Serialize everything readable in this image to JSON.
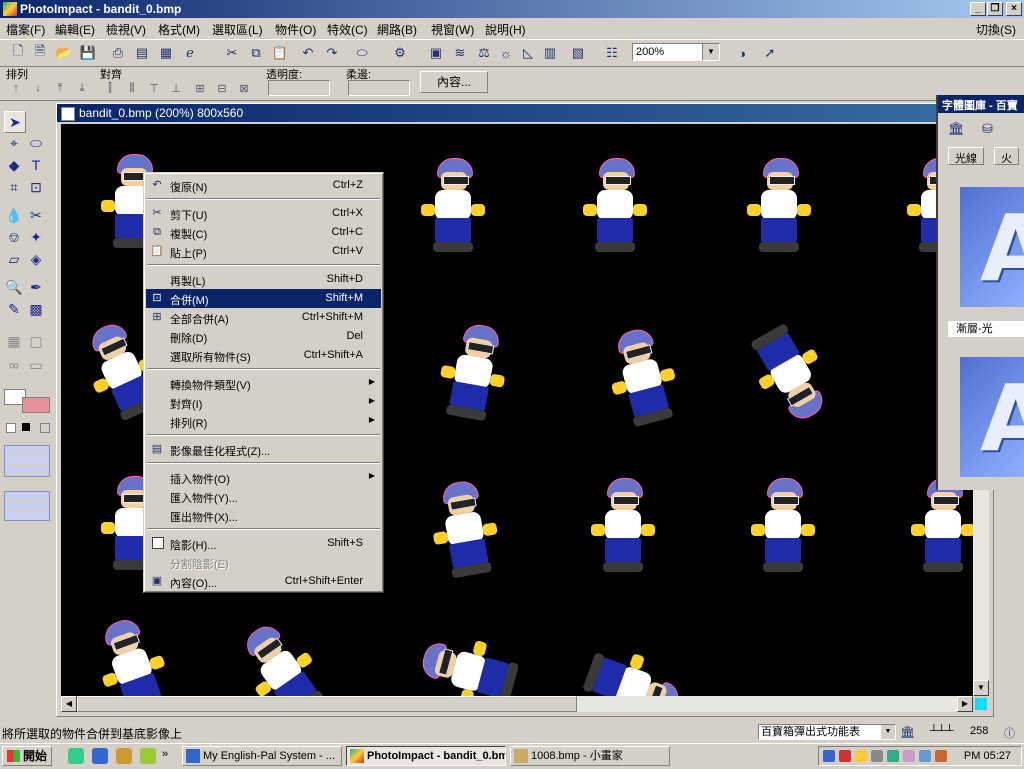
{
  "window": {
    "title": "PhotoImpact - bandit_0.bmp"
  },
  "menubar": {
    "items": [
      "檔案(F)",
      "編輯(E)",
      "檢視(V)",
      "格式(M)",
      "選取區(L)",
      "物件(O)",
      "特效(C)",
      "網路(B)",
      "視窗(W)",
      "說明(H)"
    ],
    "switch_label": "切換(S)"
  },
  "toolbar": {
    "zoom_value": "200%"
  },
  "attribute_bar": {
    "arrange_label": "排列",
    "align_label": "對齊",
    "opacity_label": "透明度:",
    "soft_edge_label": "柔邊:",
    "properties_button": "內容..."
  },
  "document": {
    "title": "bandit_0.bmp (200%) 800x560"
  },
  "context_menu": {
    "items": [
      {
        "label": "復原(N)",
        "shortcut": "Ctrl+Z"
      },
      {
        "label": "剪下(U)",
        "shortcut": "Ctrl+X"
      },
      {
        "label": "複製(C)",
        "shortcut": "Ctrl+C"
      },
      {
        "label": "貼上(P)",
        "shortcut": "Ctrl+V"
      },
      {
        "label": "再製(L)",
        "shortcut": "Shift+D"
      },
      {
        "label": "合併(M)",
        "shortcut": "Shift+M"
      },
      {
        "label": "全部合併(A)",
        "shortcut": "Ctrl+Shift+M"
      },
      {
        "label": "刪除(D)",
        "shortcut": "Del"
      },
      {
        "label": "選取所有物件(S)",
        "shortcut": "Ctrl+Shift+A"
      },
      {
        "label": "轉換物件類型(V)",
        "shortcut": ""
      },
      {
        "label": "對齊(I)",
        "shortcut": ""
      },
      {
        "label": "排列(R)",
        "shortcut": ""
      },
      {
        "label": "影像最佳化程式(Z)...",
        "shortcut": ""
      },
      {
        "label": "插入物件(O)",
        "shortcut": ""
      },
      {
        "label": "匯入物件(Y)...",
        "shortcut": ""
      },
      {
        "label": "匯出物件(X)...",
        "shortcut": ""
      },
      {
        "label": "陰影(H)...",
        "shortcut": "Shift+S"
      },
      {
        "label": "分割陰影(E)",
        "shortcut": ""
      },
      {
        "label": "內容(O)...",
        "shortcut": "Ctrl+Shift+Enter"
      }
    ],
    "highlighted_index": 5
  },
  "right_panel": {
    "title": "字體圖庫 - 百寶",
    "tab1": "光線",
    "tab2": "火",
    "tile_label": "漸層-光",
    "tile_text": "A"
  },
  "statusbar": {
    "message": "將所選取的物件合併到基底影像上",
    "combo_value": "百寶箱彈出式功能表",
    "count": "258"
  },
  "taskbar": {
    "start_label": "開始",
    "tasks": [
      "My English-Pal System - ...",
      "PhotoImpact - bandit_0.bmp",
      "1008.bmp - 小畫家"
    ],
    "clock": "PM 05:27"
  },
  "colors": {
    "title_blue": "#0a246a",
    "face": "#d4d0c8",
    "highlight": "#0a246a"
  }
}
